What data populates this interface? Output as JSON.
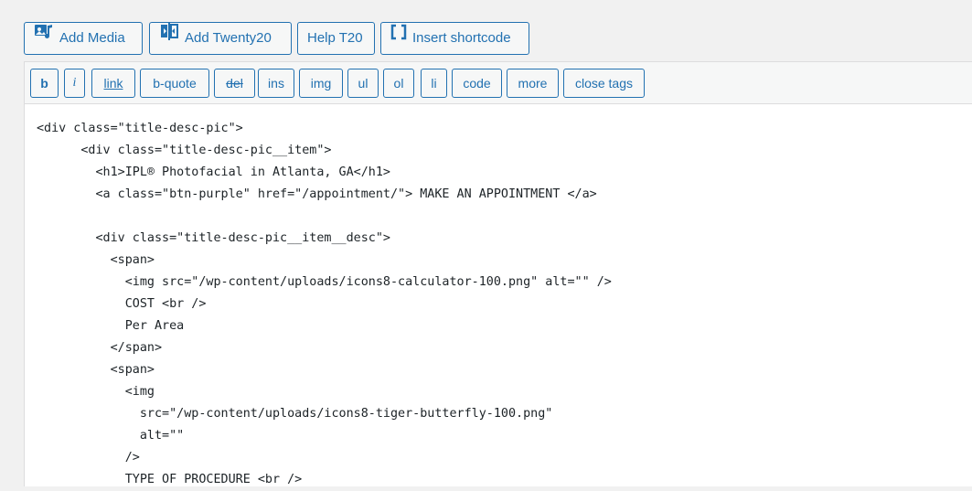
{
  "media_buttons": [
    {
      "label": "Add Media",
      "icon": "add-media-icon"
    },
    {
      "label": "Add Twenty20",
      "icon": "twenty20-icon"
    },
    {
      "label": "Help T20",
      "icon": ""
    },
    {
      "label": "Insert shortcode",
      "icon": "shortcode-brackets-icon"
    }
  ],
  "quicktags": [
    "b",
    "i",
    "link",
    "b-quote",
    "del",
    "ins",
    "img",
    "ul",
    "ol",
    "li",
    "code",
    "more",
    "close tags"
  ],
  "editor": {
    "lines": [
      "<div class=\"title-desc-pic\">",
      "      <div class=\"title-desc-pic__item\">",
      "        <h1>IPL® Photofacial in Atlanta, GA</h1>",
      "        <a class=\"btn-purple\" href=\"/appointment/\"> MAKE AN APPOINTMENT </a>",
      "",
      "        <div class=\"title-desc-pic__item__desc\">",
      "          <span>",
      "            <img src=\"/wp-content/uploads/icons8-calculator-100.png\" alt=\"\" />",
      "            COST <br />",
      "            Per Area",
      "          </span>",
      "          <span>",
      "            <img",
      "              src=\"/wp-content/uploads/icons8-tiger-butterfly-100.png\"",
      "              alt=\"\"",
      "            />",
      "            TYPE OF PROCEDURE <br />"
    ]
  },
  "colors": {
    "accent": "#2271b1",
    "toolbar_bg": "#f6f7f7",
    "page_bg": "#f1f1f1",
    "editor_bg": "#ffffff",
    "text": "#1d2327"
  }
}
